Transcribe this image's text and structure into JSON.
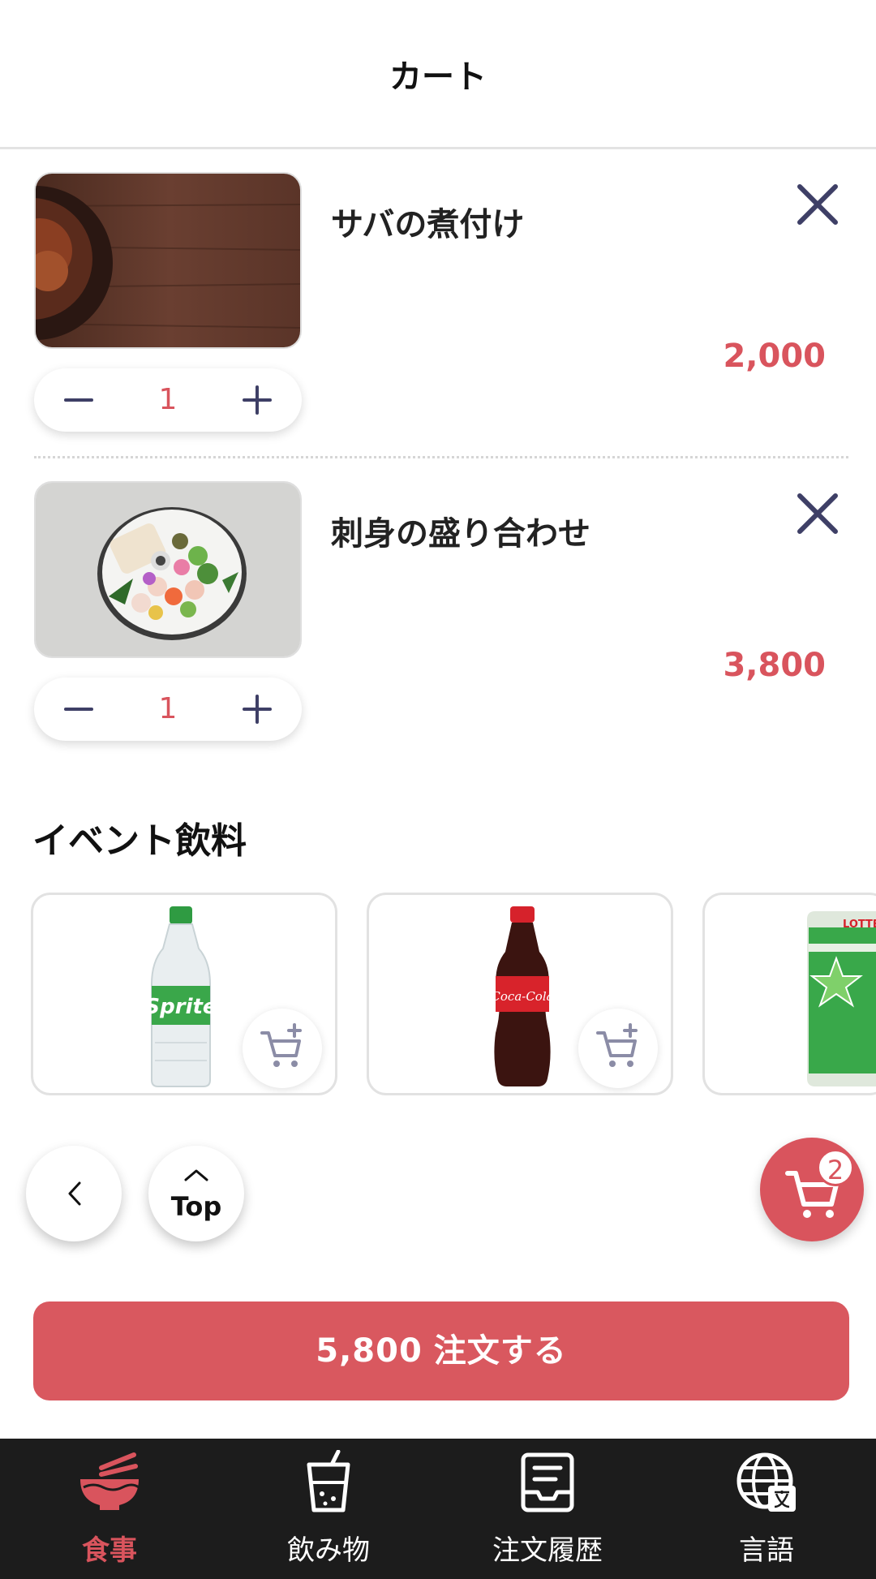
{
  "header": {
    "title": "カート"
  },
  "cart": {
    "items": [
      {
        "name": "サバの煮付け",
        "quantity": "1",
        "price": "2,000"
      },
      {
        "name": "刺身の盛り合わせ",
        "quantity": "1",
        "price": "3,800"
      }
    ]
  },
  "event_drinks": {
    "title": "イベント飲料",
    "products": [
      {
        "label": "Sprite"
      },
      {
        "label": "Coca-Cola"
      },
      {
        "label": "LOTTE"
      }
    ]
  },
  "floating": {
    "top_label": "Top",
    "cart_count": "2"
  },
  "order_button": {
    "total": "5,800",
    "label": "注文する"
  },
  "tabs": [
    {
      "label": "食事",
      "icon": "noodle-bowl-icon",
      "active": true
    },
    {
      "label": "飲み物",
      "icon": "drink-cup-icon",
      "active": false
    },
    {
      "label": "注文履歴",
      "icon": "order-history-icon",
      "active": false
    },
    {
      "label": "言語",
      "icon": "globe-language-icon",
      "active": false
    }
  ],
  "colors": {
    "accent": "#d9545d",
    "icon_navy": "#3e3f66",
    "tabbar_bg": "#1c1c1c"
  }
}
